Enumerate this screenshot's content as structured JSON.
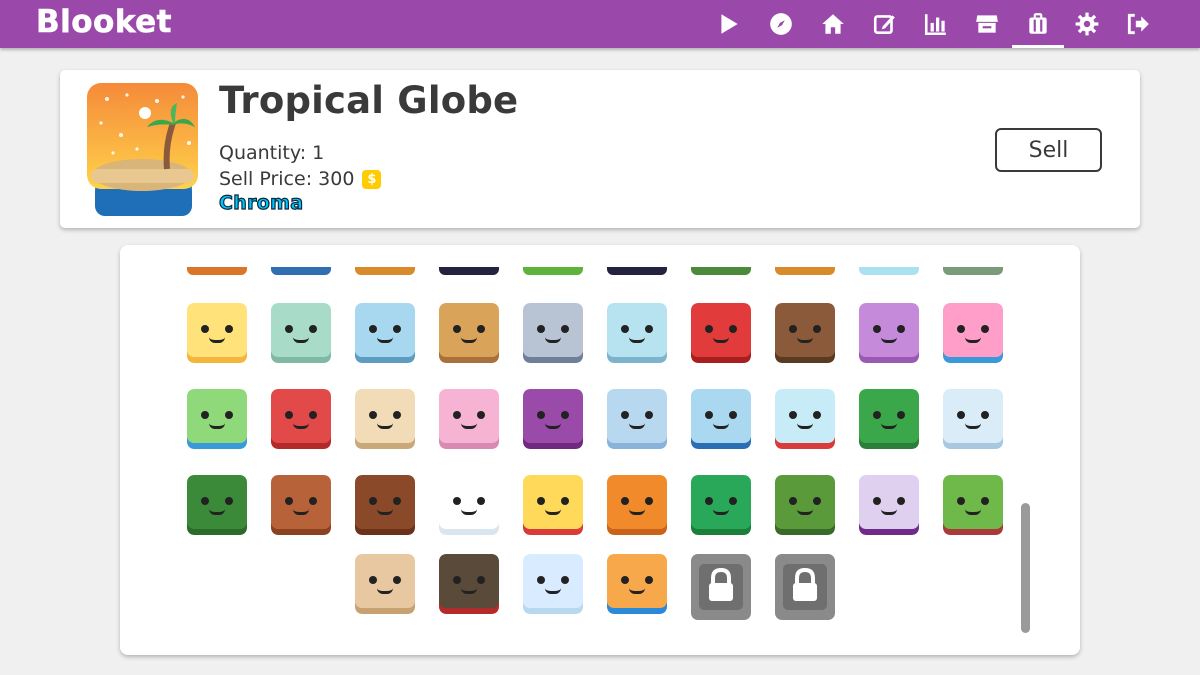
{
  "app": {
    "logo": "Blooket"
  },
  "nav": [
    {
      "name": "play-icon"
    },
    {
      "name": "discover-icon"
    },
    {
      "name": "home-icon"
    },
    {
      "name": "create-icon"
    },
    {
      "name": "stats-icon"
    },
    {
      "name": "market-icon"
    },
    {
      "name": "blooks-icon",
      "active": true
    },
    {
      "name": "settings-icon"
    },
    {
      "name": "logout-icon"
    }
  ],
  "selected": {
    "title": "Tropical Globe",
    "quantity_label": "Quantity: 1",
    "price_label": "Sell Price: 300",
    "coin_glyph": "$",
    "rarity": "Chroma",
    "sell_label": "Sell"
  },
  "colors": {
    "brand": "#9a49aa",
    "rarity": "#00c2ff"
  },
  "grid": {
    "top_strip_colors": [
      "#d9762a",
      "#2f6fb1",
      "#d98a2a",
      "#232340",
      "#5fb23a",
      "#232340",
      "#4a8a3a",
      "#d98a2a",
      "#a9e1f0",
      "#7a9a7a"
    ],
    "rows": [
      [
        {
          "name": "kawaii-cat-blook",
          "face": "#ffe27a",
          "base": "#f4b63a"
        },
        {
          "name": "robot-blook",
          "face": "#a9dcc8",
          "base": "#7fb8a3"
        },
        {
          "name": "computer-blook",
          "face": "#a8d8ef",
          "base": "#5f9dc0"
        },
        {
          "name": "crate-blook",
          "face": "#d9a35a",
          "base": "#a8703a"
        },
        {
          "name": "mad-scientist-blook",
          "face": "#b8c3d3",
          "base": "#6f7f99"
        },
        {
          "name": "brain-jar-blook",
          "face": "#b7e2f0",
          "base": "#7bb4cc"
        },
        {
          "name": "mecha-blook",
          "face": "#e23b3b",
          "base": "#a81f1f"
        },
        {
          "name": "boot-blook",
          "face": "#8a5a3a",
          "base": "#5a3a23"
        },
        {
          "name": "jellyfish-blook",
          "face": "#c58ad9",
          "base": "#9a5ab3"
        },
        {
          "name": "clownfish-blook",
          "face": "#ff9ec8",
          "base": "#3a9ad9"
        }
      ],
      [
        {
          "name": "frog-blook",
          "face": "#8fd97a",
          "base": "#3a9ad9"
        },
        {
          "name": "crab-blook",
          "face": "#e24a4a",
          "base": "#b32a2a"
        },
        {
          "name": "pufferfish-blook",
          "face": "#f2dcb8",
          "base": "#c9a87a"
        },
        {
          "name": "blobfish-blook",
          "face": "#f7b3d3",
          "base": "#d98ab3"
        },
        {
          "name": "octopus-blook",
          "face": "#9a4aa8",
          "base": "#6f2a7f"
        },
        {
          "name": "narwhal-blook",
          "face": "#b8d8f0",
          "base": "#8ab3d9"
        },
        {
          "name": "shark-blook",
          "face": "#a9d8f0",
          "base": "#2a6fb3"
        },
        {
          "name": "snow-globe-blook",
          "face": "#c8ecf7",
          "base": "#d93a3a"
        },
        {
          "name": "present-blook",
          "face": "#3aa84a",
          "base": "#2a7f3a"
        },
        {
          "name": "hot-cocoa-blook",
          "face": "#d9ecf7",
          "base": "#a8c8e0"
        }
      ],
      [
        {
          "name": "wreath-blook",
          "face": "#3a8a3a",
          "base": "#2a6a2a"
        },
        {
          "name": "gingerbread-man-blook",
          "face": "#b8623a",
          "base": "#8a4220"
        },
        {
          "name": "gingerbread-house-blook",
          "face": "#8a4a2a",
          "base": "#6a321a"
        },
        {
          "name": "snowman-blook",
          "face": "#ffffff",
          "base": "#d9e6f0"
        },
        {
          "name": "santa-claus-blook",
          "face": "#ffd95a",
          "base": "#d93a3a"
        },
        {
          "name": "jack-o-lantern-blook",
          "face": "#f08a2a",
          "base": "#c9621a"
        },
        {
          "name": "swamp-monster-blook",
          "face": "#2aa85a",
          "base": "#1a7f3a"
        },
        {
          "name": "frankenstein-blook",
          "face": "#5a9a3a",
          "base": "#3a6a2a"
        },
        {
          "name": "vampire-blook",
          "face": "#e0d0f0",
          "base": "#6f2a8a"
        },
        {
          "name": "zombie-blook",
          "face": "#6fb84a",
          "base": "#a83a3a"
        }
      ],
      [
        {
          "name": "mummy-blook",
          "face": "#e8c8a0",
          "base": "#c9a070"
        },
        {
          "name": "werewolf-blook",
          "face": "#5a4a3a",
          "base": "#b32a2a"
        },
        {
          "name": "ghost-blook",
          "face": "#d9ecff",
          "base": "#b8d8f0"
        },
        {
          "name": "tropical-globe-blook",
          "face": "#f7a84a",
          "base": "#2a8ad9"
        },
        {
          "name": "locked-blook",
          "locked": true
        },
        {
          "name": "locked-blook",
          "locked": true
        }
      ]
    ]
  }
}
